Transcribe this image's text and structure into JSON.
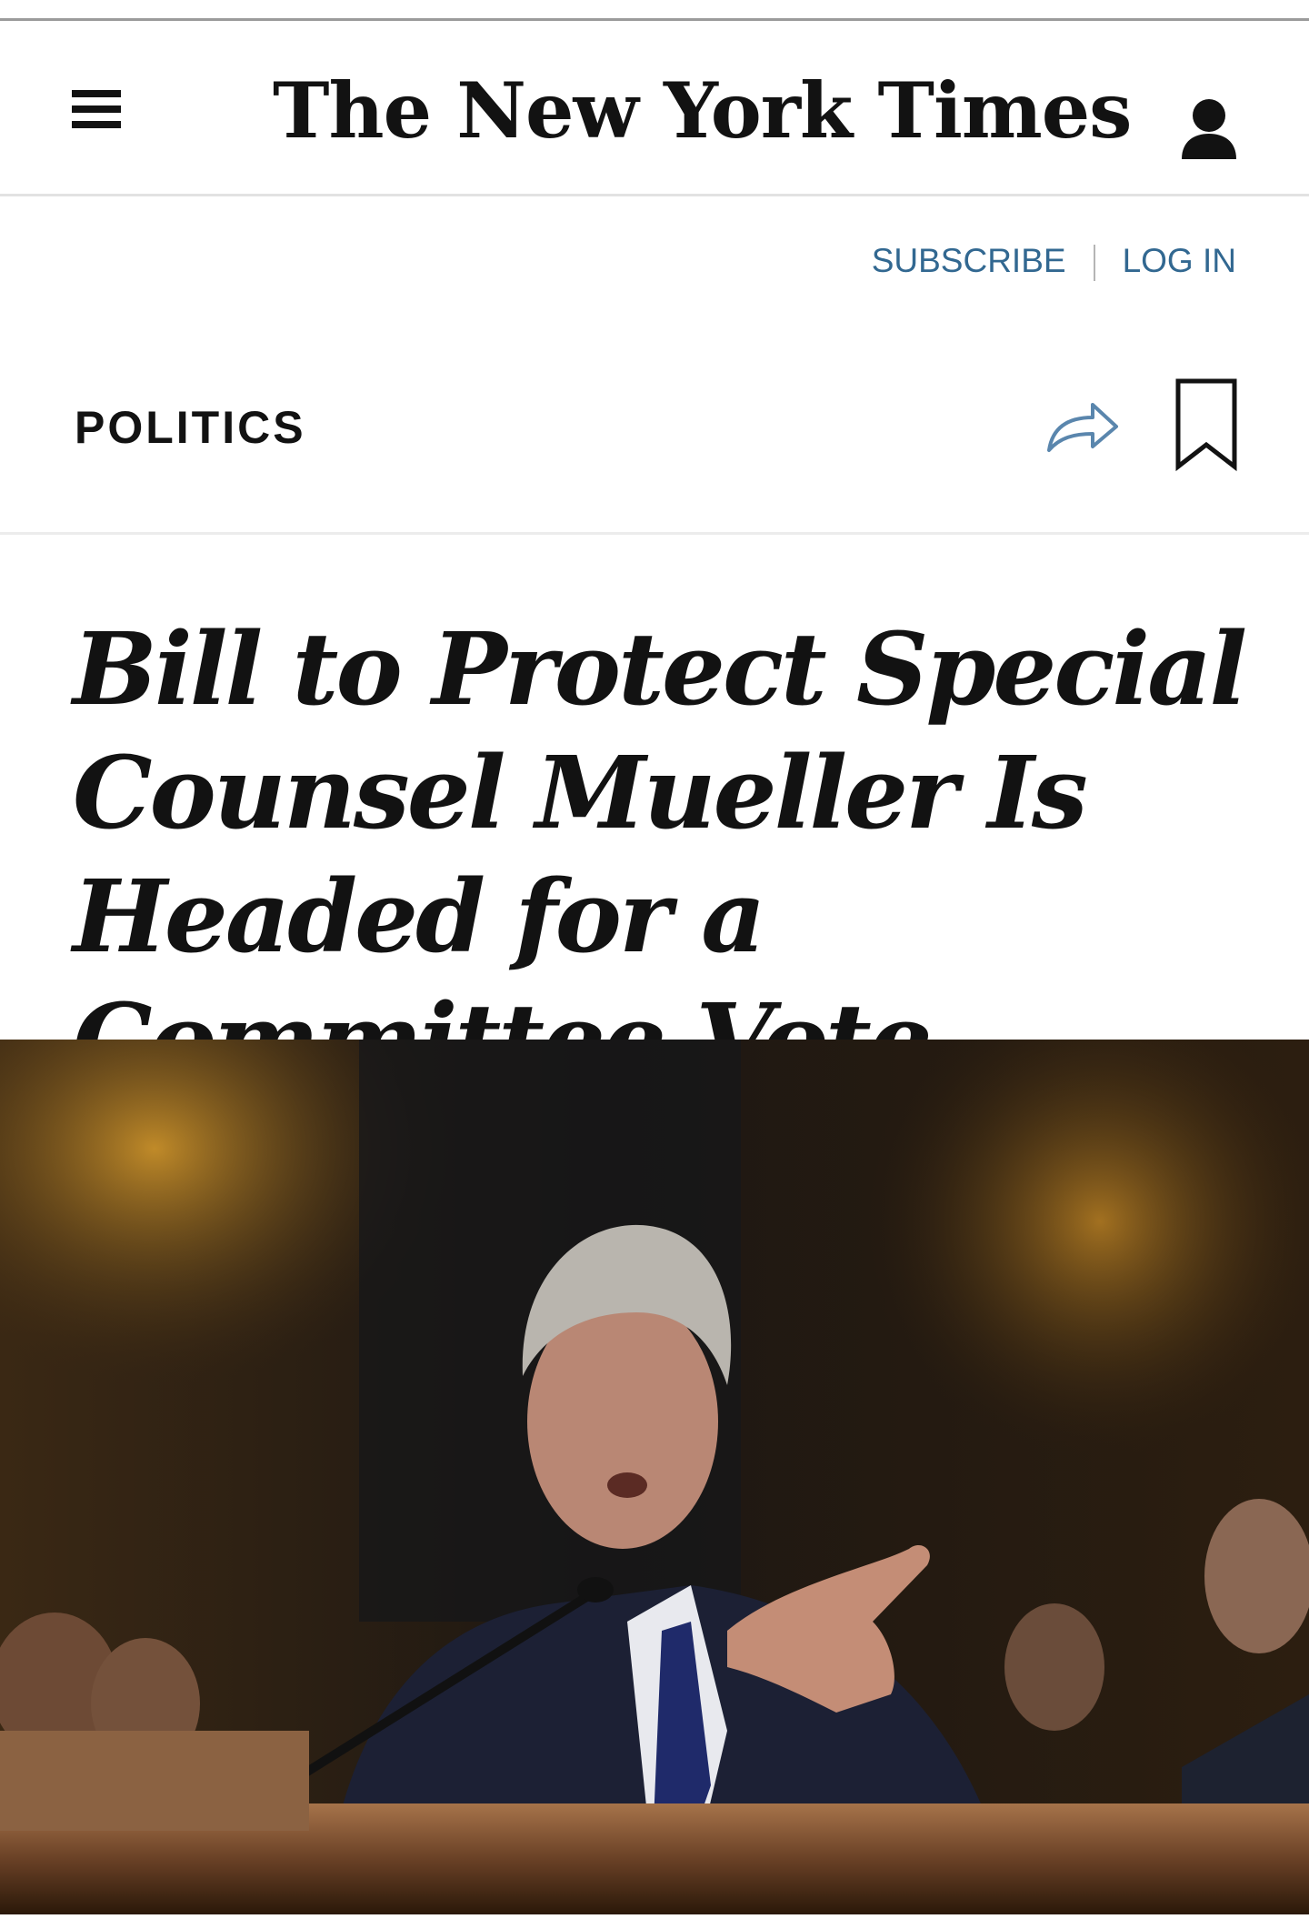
{
  "masthead": {
    "logo_text": "The New York Times",
    "menu_icon": "hamburger-menu-icon",
    "account_icon": "user-account-icon"
  },
  "auth": {
    "subscribe_label": "SUBSCRIBE",
    "login_label": "LOG IN"
  },
  "article": {
    "section": "POLITICS",
    "share_icon": "share-arrow-icon",
    "save_icon": "bookmark-icon",
    "headline": "Bill to Protect Special Counsel Mueller Is Headed for a Committee Vote"
  },
  "colors": {
    "text": "#121212",
    "link": "#326891",
    "divider": "#e2e2e2"
  }
}
